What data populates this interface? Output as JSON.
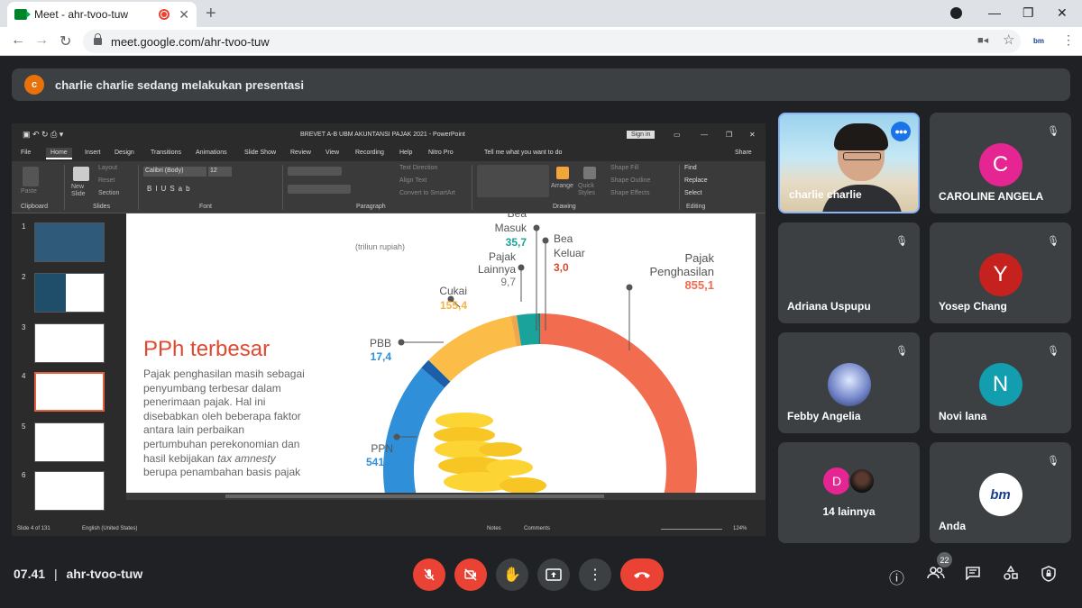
{
  "browser": {
    "tab_title": "Meet - ahr-tvoo-tuw",
    "tab_close": "✕",
    "new_tab": "+",
    "url": "meet.google.com/ahr-tvoo-tuw",
    "window_minimize": "—",
    "window_restore": "❐",
    "window_close": "✕",
    "profile_text": "bm"
  },
  "banner": {
    "avatar_letter": "c",
    "text": "charlie charlie sedang melakukan presentasi"
  },
  "powerpoint": {
    "title": "BREVET A-B UBM AKUNTANSI PAJAK 2021  -  PowerPoint",
    "sign_in": "Sign in",
    "tabs": [
      "File",
      "Home",
      "Insert",
      "Design",
      "Transitions",
      "Animations",
      "Slide Show",
      "Review",
      "View",
      "Recording",
      "Help",
      "Nitro Pro",
      "Tell me what you want to do",
      "Share"
    ],
    "ribbon_groups": [
      "Clipboard",
      "Slides",
      "Font",
      "Paragraph",
      "Drawing",
      "Editing"
    ],
    "ribbon_items": {
      "paste": "Paste",
      "new_slide": "New Slide",
      "layout": "Layout",
      "reset": "Reset",
      "section": "Section",
      "font_name": "Calibri (Body)",
      "font_size": "12",
      "text_direction": "Text Direction",
      "align_text": "Align Text",
      "convert_smartart": "Convert to SmartArt",
      "arrange": "Arrange",
      "quick_styles": "Quick Styles",
      "shape_fill": "Shape Fill",
      "shape_outline": "Shape Outline",
      "shape_effects": "Shape Effects",
      "find": "Find",
      "replace": "Replace",
      "select": "Select"
    },
    "thumb_numbers": [
      "1",
      "2",
      "3",
      "4",
      "5",
      "6"
    ],
    "status": {
      "slide_of": "Slide 4 of 131",
      "language": "English (United States)",
      "notes": "Notes",
      "comments": "Comments",
      "zoom": "124%"
    }
  },
  "slide": {
    "unit_note": "(triliun rupiah)",
    "heading": "PPh terbesar",
    "body_text": "Pajak penghasilan masih sebagai penyumbang terbesar dalam penerimaan pajak. Hal ini disebabkan oleh beberapa faktor antara lain perbaikan pertumbuhan perekonomian dan hasil kebijakan",
    "body_italic": "tax amnesty",
    "body_tail": "berupa penambahan basis pajak",
    "labels": {
      "bea_masuk": "Bea Masuk",
      "bea_masuk_val": "35,7",
      "bea_keluar": "Bea Keluar",
      "bea_keluar_val": "3,0",
      "pajak_lainnya": "Pajak Lainnya",
      "pajak_lainnya_val": "9,7",
      "cukai": "Cukai",
      "cukai_val": "155,4",
      "pbb": "PBB",
      "pbb_val": "17,4",
      "ppn": "PPN",
      "ppn_val": "541,8",
      "pajak_penghasilan": "Pajak Penghasilan",
      "pajak_penghasilan_val": "855,1"
    }
  },
  "chart_data": {
    "type": "pie",
    "categories": [
      "Pajak Penghasilan",
      "PPN",
      "PBB",
      "Cukai",
      "Pajak Lainnya",
      "Bea Masuk",
      "Bea Keluar"
    ],
    "values": [
      855.1,
      541.8,
      17.4,
      155.4,
      9.7,
      35.7,
      3.0
    ],
    "colors": [
      "#f26c4f",
      "#2f8fd8",
      "#1c5fa8",
      "#fbbd47",
      "#f0a64a",
      "#1aa39a",
      "#0d7f7a"
    ]
  },
  "participants": [
    {
      "name": "charlie charlie",
      "type": "camera"
    },
    {
      "name": "CAROLINE ANGELA",
      "letter": "C",
      "color": "#e52592"
    },
    {
      "name": "Adriana Uspupu"
    },
    {
      "name": "Yosep Chang",
      "letter": "Y",
      "color": "#c5221f"
    },
    {
      "name": "Febby Angelia"
    },
    {
      "name": "Novi lana",
      "letter": "N",
      "color": "#129eaf"
    },
    {
      "name": "14 lainnya",
      "letter": "D",
      "color": "#e52592"
    },
    {
      "name": "Anda",
      "logo_text": "bm"
    }
  ],
  "controls": {
    "time": "07.41",
    "divider": "|",
    "meeting_code": "ahr-tvoo-tuw",
    "people_count": "22"
  }
}
